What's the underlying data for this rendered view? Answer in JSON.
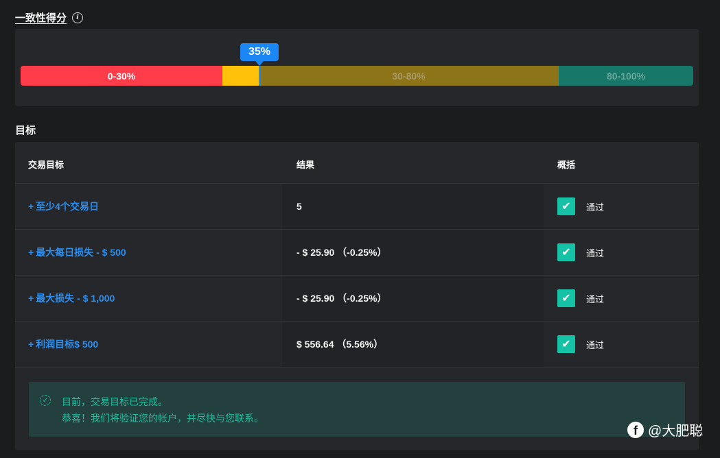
{
  "consistency": {
    "title": "一致性得分",
    "info_icon": "info-icon",
    "score_label": "35%",
    "score_value": 35,
    "segments": [
      {
        "label": "0-30%",
        "color": "#ff3d4a"
      },
      {
        "label": "",
        "color": "#ffc10a"
      },
      {
        "label": "30-80%",
        "color": "#8d7418"
      },
      {
        "label": "80-100%",
        "color": "#177869"
      }
    ]
  },
  "goals": {
    "title": "目标",
    "headers": {
      "goal": "交易目标",
      "result": "结果",
      "summary": "概括"
    },
    "rows": [
      {
        "plus": "+",
        "goal": "至少4个交易日",
        "result": "5",
        "status": "通过"
      },
      {
        "plus": "+",
        "goal": "最大每日损失 - $ 500",
        "result": "- $ 25.90 （-0.25%）",
        "status": "通过"
      },
      {
        "plus": "+",
        "goal": "最大损失 - $ 1,000",
        "result": "- $ 25.90 （-0.25%）",
        "status": "通过"
      },
      {
        "plus": "+",
        "goal": "利润目标$ 500",
        "result": "$ 556.64 （5.56%）",
        "status": "通过"
      }
    ],
    "notice": {
      "line1": "目前，交易目标已完成。",
      "line2": "恭喜！我们将验证您的帐户，并尽快与您联系。"
    }
  },
  "watermark": {
    "text": "@大肥聪",
    "icon": "facebook-icon"
  },
  "colors": {
    "background": "#1b1c1e",
    "card": "#26272a",
    "link_blue": "#2b8ff0",
    "success_teal": "#16c2a6",
    "tooltip_blue": "#1a87f5"
  }
}
